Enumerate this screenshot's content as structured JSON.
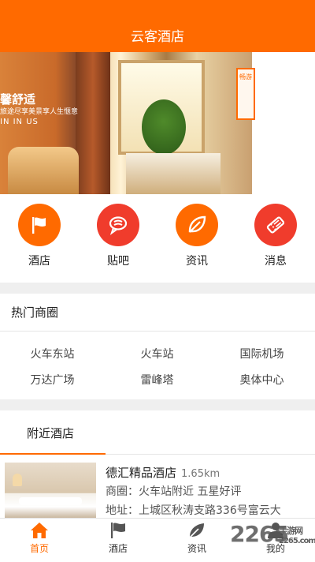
{
  "header": {
    "title": "云客酒店"
  },
  "banner": {
    "overlay_line1": "馨舒适",
    "overlay_line2": "旅途尽享美景享人生惬意",
    "overlay_line3": "IN IN US",
    "sign_text": "畅游"
  },
  "quick": [
    {
      "label": "酒店",
      "icon": "flag-icon",
      "color": "#ff6a00"
    },
    {
      "label": "贴吧",
      "icon": "chat-icon",
      "color": "#f03c2c"
    },
    {
      "label": "资讯",
      "icon": "leaf-icon",
      "color": "#ff6a00"
    },
    {
      "label": "消息",
      "icon": "ticket-icon",
      "color": "#f03c2c"
    }
  ],
  "hot": {
    "title": "热门商圈",
    "areas": [
      "火车东站",
      "火车站",
      "国际机场",
      "万达广场",
      "雷峰塔",
      "奥体中心"
    ]
  },
  "nearby": {
    "title": "附近酒店",
    "hotel": {
      "name": "德汇精品酒店",
      "distance": "1.65km",
      "meta": "商圈：火车站附近   五星好评",
      "address": "地址：上城区秋涛支路336号富云大"
    }
  },
  "bottom_nav": [
    {
      "label": "首页",
      "icon": "home-icon",
      "active": true
    },
    {
      "label": "酒店",
      "icon": "flag-icon",
      "active": false
    },
    {
      "label": "资讯",
      "icon": "leaf-icon",
      "active": false
    },
    {
      "label": "我的",
      "icon": "user-icon",
      "active": false
    }
  ],
  "watermark": {
    "brand": "2265",
    "sub": "手游网",
    "url": "2265.com"
  }
}
